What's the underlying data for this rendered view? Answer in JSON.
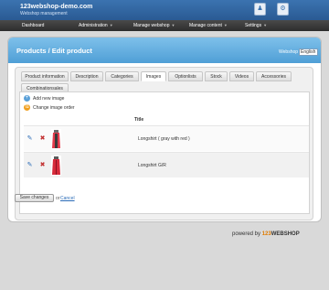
{
  "header": {
    "title": "123webshop-demo.com",
    "subtitle": "Webshop management",
    "icons": [
      "user-icon",
      "settings-icon"
    ]
  },
  "nav": [
    "Dashboard",
    "Administration",
    "Manage webshop",
    "Manage content",
    "Settings"
  ],
  "page": {
    "title": "Products / Edit product",
    "language_label": "Webshop",
    "language_value": "English"
  },
  "tabs": [
    "Product information",
    "Description",
    "Categories",
    "Images",
    "Optionlists",
    "Stock",
    "Videos",
    "Accessories",
    "Combinationsales"
  ],
  "active_tab": "Images",
  "actions": {
    "add": "Add new image",
    "order": "Change image order"
  },
  "table": {
    "column_title": "Title",
    "rows": [
      {
        "title": "Longshirt ( gray with red )",
        "colors": [
          "#e23a4a",
          "#3a3a3a"
        ]
      },
      {
        "title": "Longshirt G/R",
        "colors": [
          "#d62a3a",
          "#c21f2f"
        ]
      }
    ]
  },
  "buttons": {
    "save": "Save changes",
    "or": "or",
    "cancel": "Cancel"
  },
  "footer": {
    "prefix": "powered by",
    "brand_num": "123",
    "brand_text": "WEBSHOP"
  },
  "colors": {
    "brand_blue": "#3b73b0",
    "header_blue": "#5ea8dc",
    "brand_orange": "#e07b00"
  }
}
